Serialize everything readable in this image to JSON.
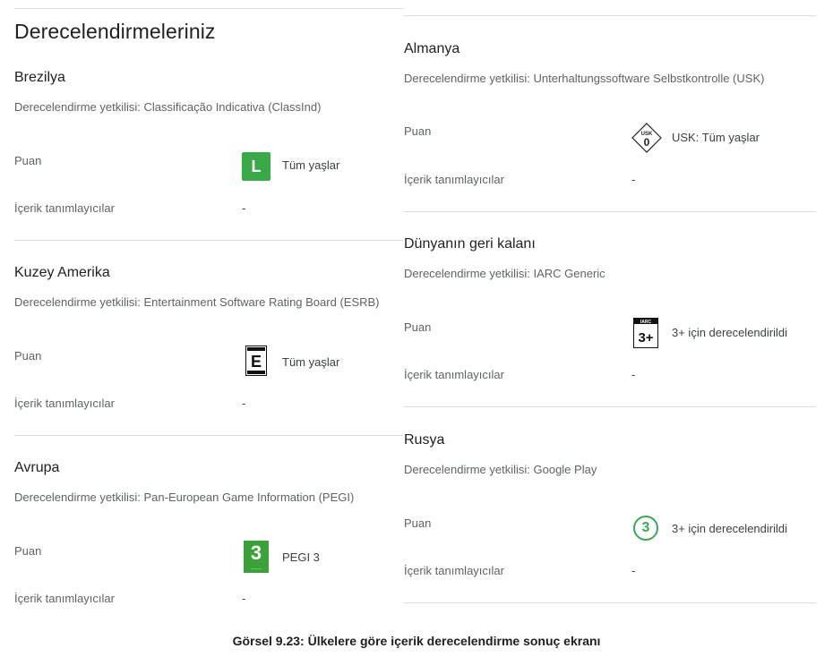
{
  "page": {
    "title": "Derecelendirmeleriniz",
    "caption": "Görsel 9.23: Ülkelere göre içerik derecelendirme sonuç ekranı"
  },
  "labels": {
    "rating": "Puan",
    "descriptors": "İçerik tanımlayıcılar",
    "authority_prefix": "Derecelendirme yetkilisi: "
  },
  "sections": [
    {
      "name": "Brezilya",
      "authority": "Derecelendirme yetkilisi: Classificação Indicativa (ClassInd)",
      "badge_text": "L",
      "badge_icon": "classind-l-icon",
      "rating": "Tüm yaşlar",
      "descriptors": "-"
    },
    {
      "name": "Kuzey Amerika",
      "authority": "Derecelendirme yetkilisi: Entertainment Software Rating Board (ESRB)",
      "badge_text": "E",
      "badge_icon": "esrb-e-icon",
      "rating": "Tüm yaşlar",
      "descriptors": "-"
    },
    {
      "name": "Avrupa",
      "authority": "Derecelendirme yetkilisi: Pan-European Game Information (PEGI)",
      "badge_text": "3",
      "badge_icon": "pegi-3-icon",
      "rating": "PEGI 3",
      "descriptors": "-"
    },
    {
      "name": "Almanya",
      "authority": "Derecelendirme yetkilisi: Unterhaltungssoftware Selbstkontrolle (USK)",
      "badge_text": "0",
      "badge_icon": "usk-0-icon",
      "rating": "USK: Tüm yaşlar",
      "descriptors": "-"
    },
    {
      "name": "Dünyanın geri kalanı",
      "authority": "Derecelendirme yetkilisi: IARC Generic",
      "badge_text": "3+",
      "badge_icon": "iarc-3-icon",
      "rating": "3+ için derecelendirildi",
      "descriptors": "-"
    },
    {
      "name": "Rusya",
      "authority": "Derecelendirme yetkilisi: Google Play",
      "badge_text": "3",
      "badge_icon": "google-play-3-icon",
      "rating": "3+ için derecelendirildi",
      "descriptors": "-"
    }
  ],
  "colors": {
    "classind_green": "#3aaa48",
    "pegi_green": "#3aa238",
    "google_play_green": "#3aa956",
    "divider": "#dadce0"
  }
}
